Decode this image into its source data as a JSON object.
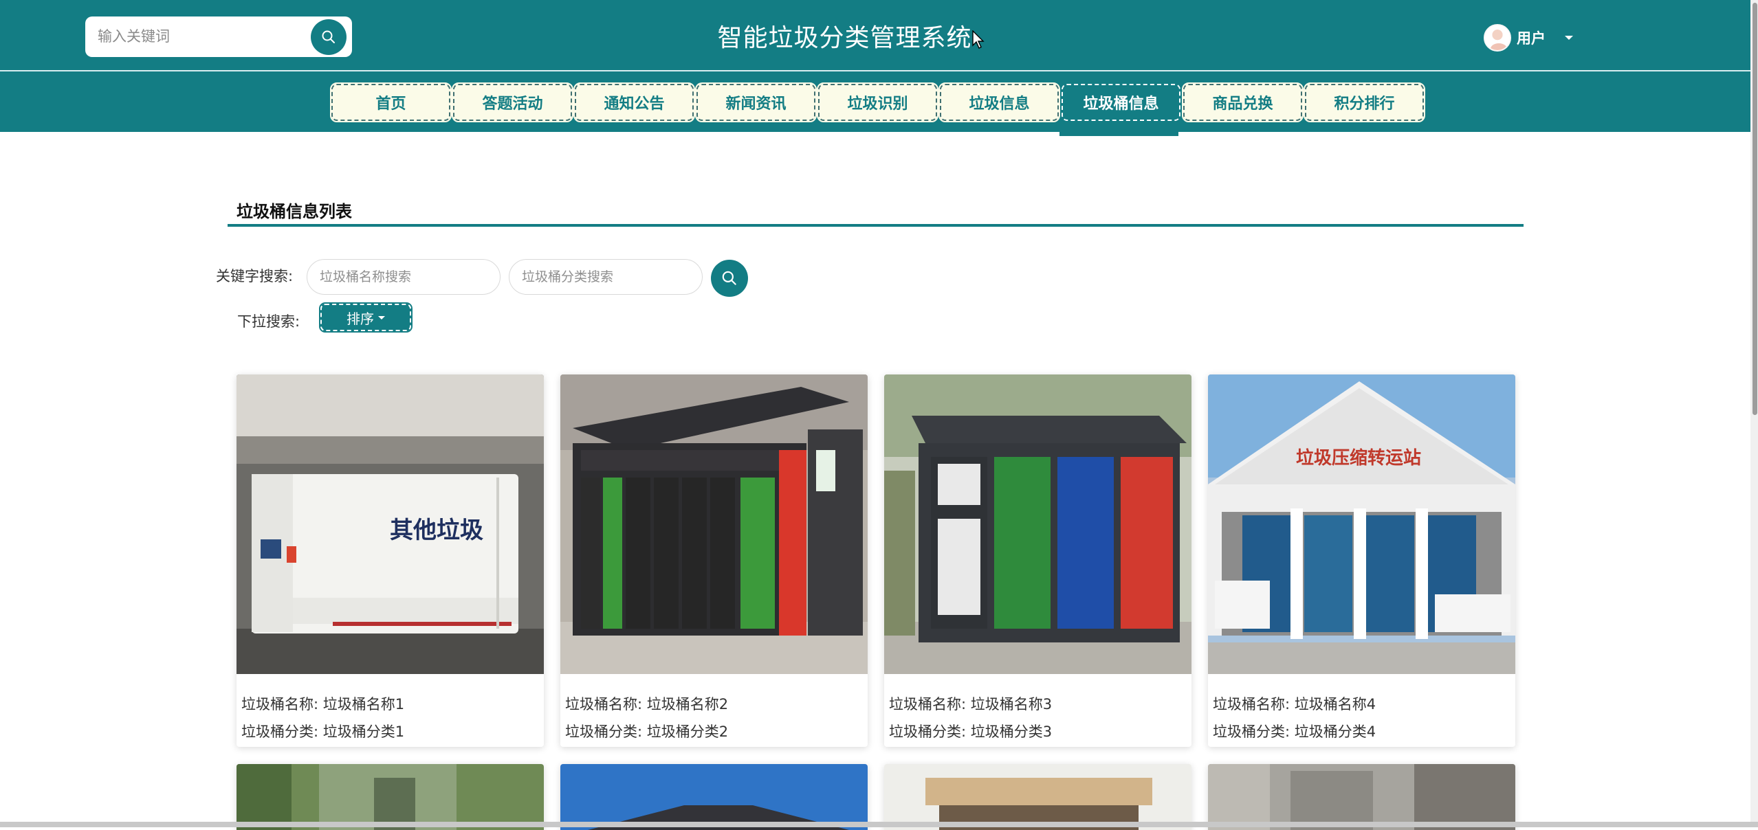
{
  "header": {
    "search_placeholder": "输入关键词",
    "app_title": "智能垃圾分类管理系统",
    "user_label": "用户"
  },
  "nav": {
    "items": [
      {
        "label": "首页"
      },
      {
        "label": "答题活动"
      },
      {
        "label": "通知公告"
      },
      {
        "label": "新闻资讯"
      },
      {
        "label": "垃圾识别"
      },
      {
        "label": "垃圾信息"
      },
      {
        "label": "垃圾桶信息",
        "active": true
      },
      {
        "label": "商品兑换"
      },
      {
        "label": "积分排行"
      }
    ]
  },
  "content": {
    "section_title": "垃圾桶信息列表",
    "keyword_label": "关键字搜索:",
    "name_placeholder": "垃圾桶名称搜索",
    "type_placeholder": "垃圾桶分类搜索",
    "dropdown_label": "下拉搜索:",
    "sort_label": "排序"
  },
  "cards": [
    {
      "name_line": "垃圾桶名称: 垃圾桶名称1",
      "type_line": "垃圾桶分类: 垃圾桶分类1",
      "image": "compactor-truck-image",
      "image_text": "其他垃圾"
    },
    {
      "name_line": "垃圾桶名称: 垃圾桶名称2",
      "type_line": "垃圾桶分类: 垃圾桶分类2",
      "image": "sorting-kiosk-image"
    },
    {
      "name_line": "垃圾桶名称: 垃圾桶名称3",
      "type_line": "垃圾桶分类: 垃圾桶分类3",
      "image": "colored-bins-station-image"
    },
    {
      "name_line": "垃圾桶名称: 垃圾桶名称4",
      "type_line": "垃圾桶分类: 垃圾桶分类4",
      "image": "transfer-station-image",
      "image_text": "垃圾压缩转运站"
    }
  ],
  "colors": {
    "primary": "#137d84",
    "nav_bg": "#fbfbe8",
    "white": "#ffffff"
  }
}
